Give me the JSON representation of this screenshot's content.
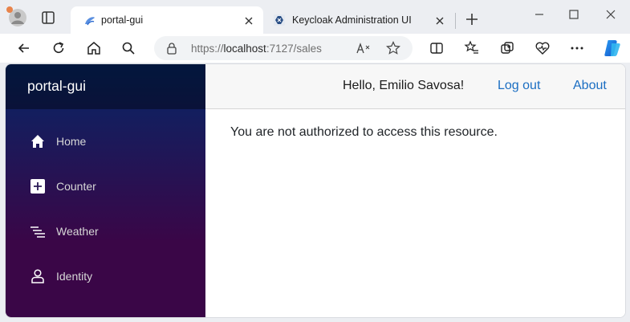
{
  "browser": {
    "tabs": [
      {
        "title": "portal-gui",
        "active": true
      },
      {
        "title": "Keycloak Administration UI",
        "active": false
      }
    ],
    "address": {
      "scheme": "https://",
      "host": "localhost",
      "path": ":7127/sales"
    }
  },
  "app": {
    "brand": "portal-gui",
    "nav": [
      {
        "label": "Home",
        "icon": "home-icon"
      },
      {
        "label": "Counter",
        "icon": "plus-square-icon"
      },
      {
        "label": "Weather",
        "icon": "list-lines-icon"
      },
      {
        "label": "Identity",
        "icon": "person-icon"
      }
    ],
    "header": {
      "greeting": "Hello, Emilio Savosa!",
      "logout": "Log out",
      "about": "About"
    },
    "message": "You are not authorized to access this resource."
  },
  "colors": {
    "sidebar_top": "#052767",
    "sidebar_bottom": "#3a0647",
    "link": "#1b6ec2"
  }
}
